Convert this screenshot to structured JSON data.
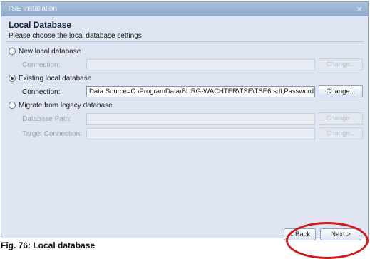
{
  "window": {
    "title": "TSE Installation",
    "close_glyph": "×"
  },
  "page": {
    "heading": "Local Database",
    "subtitle": "Please choose the local database settings"
  },
  "options": {
    "new_db": {
      "label": "New local database",
      "checked": false,
      "connection_label": "Connection:",
      "connection_value": "",
      "button_label": "Change..."
    },
    "existing_db": {
      "label": "Existing local database",
      "checked": true,
      "connection_label": "Connection:",
      "connection_value": "Data Source=C:\\ProgramData\\BURG-WACHTER\\TSE\\TSE6.sdf;Password",
      "button_label": "Change..."
    },
    "legacy": {
      "label": "Migrate from legacy database",
      "checked": false,
      "db_path_label": "Database Path:",
      "db_path_value": "",
      "target_label": "Target Connection:",
      "target_value": "",
      "browse_button_label": "Change...",
      "target_button_label": "Change..."
    }
  },
  "footer": {
    "back_label": "< Back",
    "next_label": "Next >"
  },
  "caption": "Fig. 76: Local database",
  "colors": {
    "annotation_ring": "#d11a1a",
    "title_bar": "#9bb3d4"
  }
}
